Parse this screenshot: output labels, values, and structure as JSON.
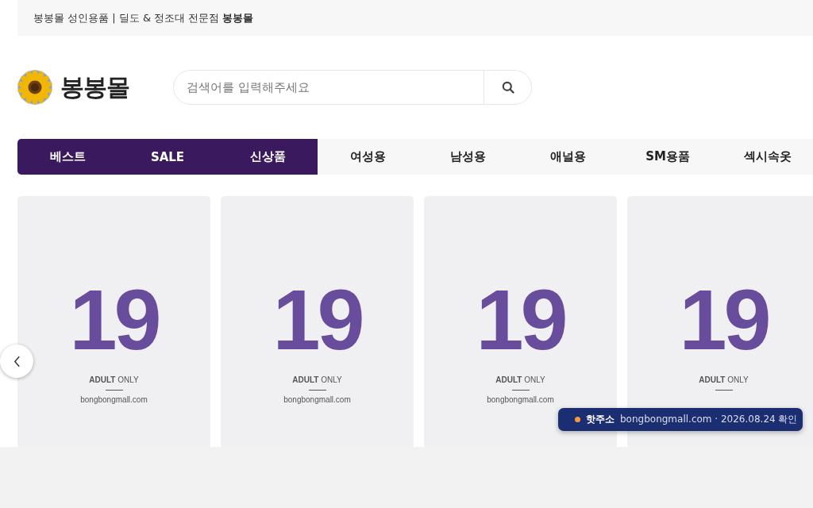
{
  "top_bar": {
    "text": "봉봉몰 성인용품 | 딜도 & 정조대 전문점 **봉봉몰**"
  },
  "header": {
    "logo_text": "봉봉몰",
    "search": {
      "placeholder": "검색어를 입력해주세요"
    }
  },
  "nav": [
    {
      "label": "베스트",
      "highlighted": true
    },
    {
      "label": "SALE",
      "highlighted": true
    },
    {
      "label": "신상품",
      "highlighted": true
    },
    {
      "label": "여성용",
      "highlighted": false
    },
    {
      "label": "남성용",
      "highlighted": false
    },
    {
      "label": "애널용",
      "highlighted": false
    },
    {
      "label": "SM용품",
      "highlighted": false
    },
    {
      "label": "섹시속옷",
      "highlighted": false
    }
  ],
  "products": [
    {
      "age": "19",
      "notice": "**ADULT** ONLY",
      "domain": "bongbongmall.com"
    },
    {
      "age": "19",
      "notice": "**ADULT** ONLY",
      "domain": "bongbongmall.com"
    },
    {
      "age": "19",
      "notice": "**ADULT** ONLY",
      "domain": "bongbongmall.com"
    },
    {
      "age": "19",
      "notice": "**ADULT** ONLY"
    }
  ],
  "hot_address": {
    "label": "핫주소",
    "text": "bongbongmall.com · 2026.08.24 확인"
  }
}
